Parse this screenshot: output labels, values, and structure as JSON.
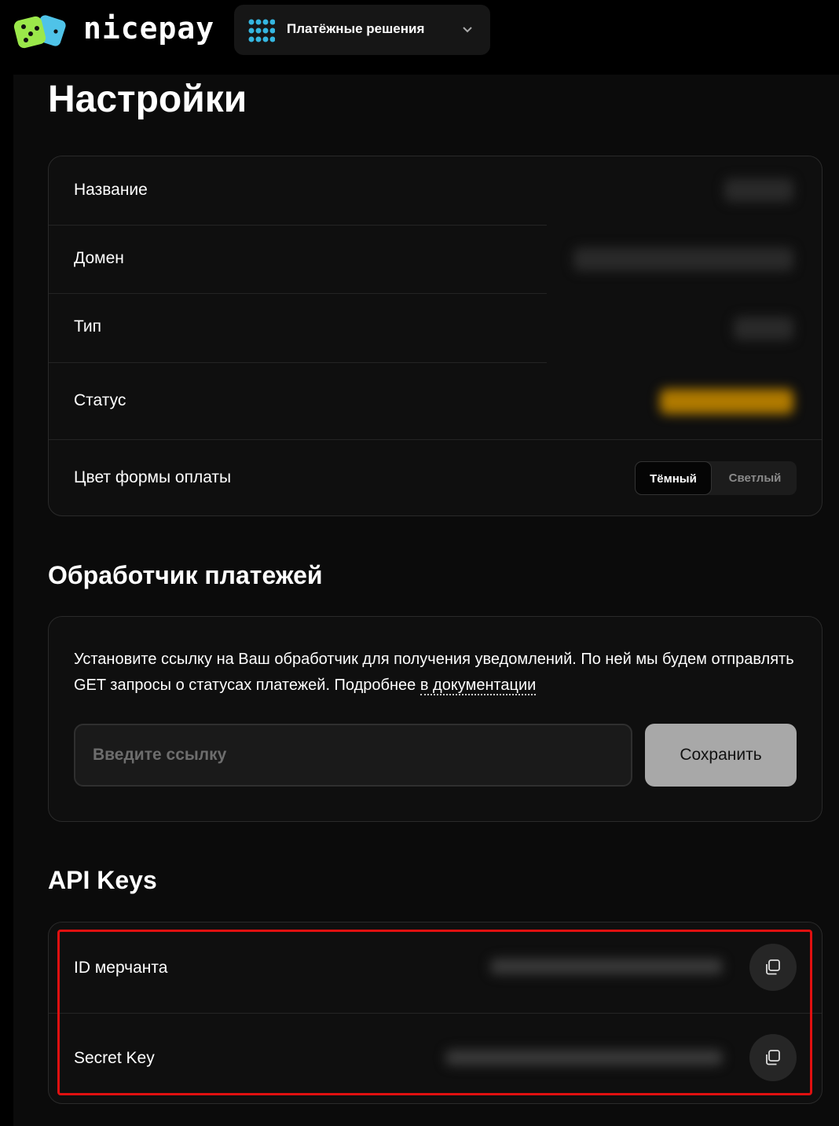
{
  "brand": {
    "name": "nicepay",
    "logo": "dice-logo-icon"
  },
  "product_switcher": {
    "label": "Платёжные решения",
    "icon": "grid-dots-icon",
    "chevron": "chevron-down-icon"
  },
  "page_title": "Настройки",
  "settings": {
    "rows": [
      {
        "label": "Название"
      },
      {
        "label": "Домен"
      },
      {
        "label": "Тип"
      },
      {
        "label": "Статус"
      },
      {
        "label": "Цвет формы оплаты"
      }
    ],
    "theme_toggle": {
      "options": [
        "Тёмный",
        "Светлый"
      ],
      "selected": "Тёмный"
    }
  },
  "handler": {
    "title": "Обработчик платежей",
    "description": "Установите ссылку на Ваш обработчик для получения уведомлений. По ней мы будем отправлять GET запросы о статусах платежей. Подробнее ",
    "doc_link": "в документации",
    "input_placeholder": "Введите ссылку",
    "input_value": "",
    "save_label": "Сохранить"
  },
  "api_keys": {
    "title": "API Keys",
    "rows": [
      {
        "label": "ID мерчанта",
        "copy_icon": "copy-icon"
      },
      {
        "label": "Secret Key",
        "copy_icon": "copy-icon"
      }
    ]
  },
  "colors": {
    "background": "#000000",
    "panel": "#0b0b0b",
    "status_blur": "#c98a00",
    "highlight": "#e01010"
  }
}
